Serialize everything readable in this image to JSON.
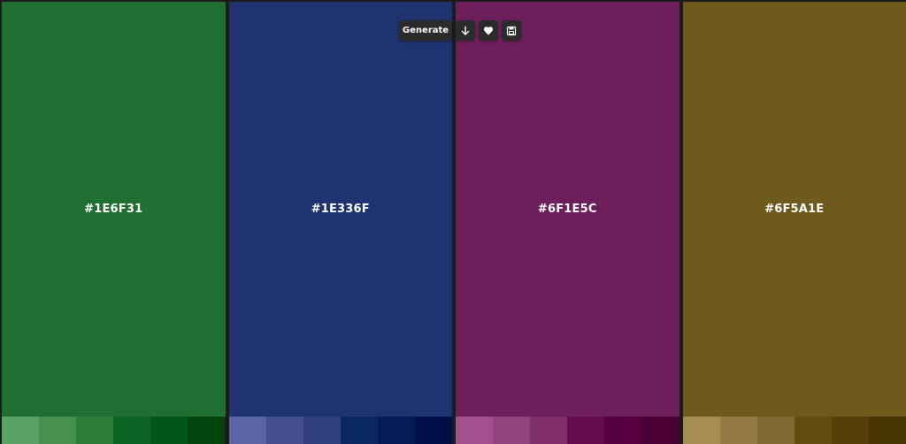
{
  "toolbar": {
    "generate_label": "Generate",
    "icons": [
      "arrow-down-icon",
      "heart-icon",
      "save-icon"
    ]
  },
  "palette": {
    "columns": [
      {
        "hex": "#1E6F31",
        "color": "#1E6F31",
        "shades": [
          "#5aa365",
          "#45904f",
          "#2e7d3b",
          "#0c6424",
          "#035618",
          "#00460a"
        ]
      },
      {
        "hex": "#1E336F",
        "color": "#1E336F",
        "shades": [
          "#5b65a6",
          "#444f92",
          "#313e80",
          "#0a2860",
          "#041c54",
          "#000e48"
        ]
      },
      {
        "hex": "#6F1E5C",
        "color": "#6F1E5C",
        "shades": [
          "#a5508e",
          "#92427d",
          "#802f6b",
          "#650b4d",
          "#560041",
          "#490034"
        ]
      },
      {
        "hex": "#6F5A1E",
        "color": "#6F5A1E",
        "shades": [
          "#a68c50",
          "#937b41",
          "#806a2f",
          "#624c10",
          "#544006",
          "#473300"
        ]
      }
    ]
  }
}
